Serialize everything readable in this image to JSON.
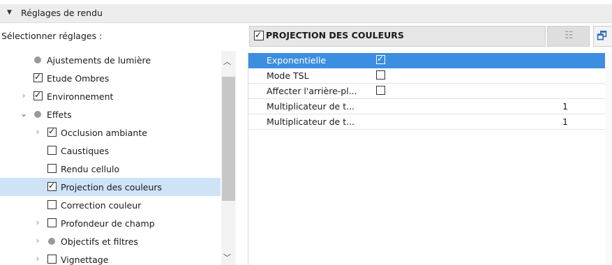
{
  "header": {
    "title": "Réglages de rendu"
  },
  "select_label": "Sélectionner réglages :",
  "tree": [
    {
      "label": "Ajustements de lumière",
      "kind": "dot",
      "level": 1,
      "expander": "none",
      "checked": false,
      "selected": false
    },
    {
      "label": "Etude Ombres",
      "kind": "checkbox",
      "level": 1,
      "expander": "none",
      "checked": true,
      "selected": false
    },
    {
      "label": "Environnement",
      "kind": "checkbox",
      "level": 1,
      "expander": "collapsed",
      "checked": true,
      "selected": false
    },
    {
      "label": "Effets",
      "kind": "dot",
      "level": 1,
      "expander": "expanded",
      "checked": false,
      "selected": false
    },
    {
      "label": "Occlusion ambiante",
      "kind": "checkbox",
      "level": 2,
      "expander": "collapsed",
      "checked": true,
      "selected": false
    },
    {
      "label": "Caustiques",
      "kind": "checkbox",
      "level": 2,
      "expander": "none",
      "checked": false,
      "selected": false
    },
    {
      "label": "Rendu cellulo",
      "kind": "checkbox",
      "level": 2,
      "expander": "none",
      "checked": false,
      "selected": false
    },
    {
      "label": "Projection des couleurs",
      "kind": "checkbox",
      "level": 2,
      "expander": "none",
      "checked": true,
      "selected": true
    },
    {
      "label": "Correction couleur",
      "kind": "checkbox",
      "level": 2,
      "expander": "none",
      "checked": false,
      "selected": false
    },
    {
      "label": "Profondeur de champ",
      "kind": "checkbox",
      "level": 2,
      "expander": "collapsed",
      "checked": false,
      "selected": false
    },
    {
      "label": "Objectifs et filtres",
      "kind": "dot",
      "level": 2,
      "expander": "collapsed",
      "checked": false,
      "selected": false
    },
    {
      "label": "Vignettage",
      "kind": "checkbox",
      "level": 2,
      "expander": "collapsed",
      "checked": false,
      "selected": false
    }
  ],
  "panel": {
    "title": "PROJECTION DES COULEURS",
    "checked": true,
    "list_icon": "list-view-icon",
    "export_icon": "export-settings-icon"
  },
  "properties": [
    {
      "name": "Exponentielle",
      "type": "checkbox",
      "checked": true,
      "value": "",
      "selected": true
    },
    {
      "name": "Mode TSL",
      "type": "checkbox",
      "checked": false,
      "value": "",
      "selected": false
    },
    {
      "name": "Affecter l'arrière-pl...",
      "type": "checkbox",
      "checked": false,
      "value": "",
      "selected": false
    },
    {
      "name": "Multiplicateur de t...",
      "type": "number",
      "checked": false,
      "value": "1",
      "selected": false
    },
    {
      "name": "Multiplicateur de t...",
      "type": "number",
      "checked": false,
      "value": "1",
      "selected": false
    }
  ],
  "colors": {
    "selection_blue": "#3c8ee0",
    "tree_selection": "#cfe3f7"
  }
}
